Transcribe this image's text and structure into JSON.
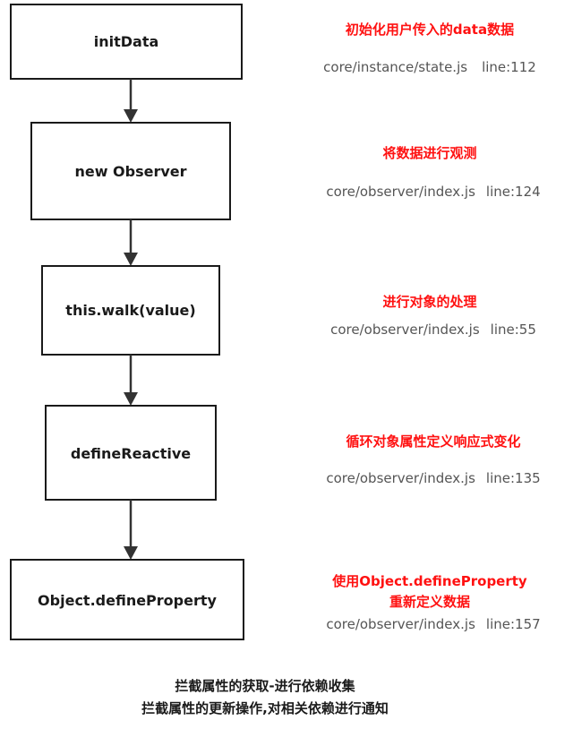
{
  "colors": {
    "accent_red": "#ff1111",
    "box_stroke": "#1a1a1a",
    "arrow": "#333333",
    "file_text": "#555555"
  },
  "steps": [
    {
      "label": "initData",
      "note_title": "初始化用户传入的data数据",
      "note_title_line2": "",
      "file": "core/instance/state.js",
      "line": "line:112"
    },
    {
      "label": "new Observer",
      "note_title": "将数据进行观测",
      "note_title_line2": "",
      "file": "core/observer/index.js",
      "line": "line:124"
    },
    {
      "label": "this.walk(value)",
      "note_title": "进行对象的处理",
      "note_title_line2": "",
      "file": "core/observer/index.js",
      "line": "line:55"
    },
    {
      "label": "defineReactive",
      "note_title": "循环对象属性定义响应式变化",
      "note_title_line2": "",
      "file": "core/observer/index.js",
      "line": "line:135"
    },
    {
      "label": "Object.defineProperty",
      "note_title": "使用Object.defineProperty",
      "note_title_line2": "重新定义数据",
      "file": "core/observer/index.js",
      "line": "line:157"
    }
  ],
  "footer": {
    "line1": "拦截属性的获取-进行依赖收集",
    "line2": "拦截属性的更新操作,对相关依赖进行通知"
  }
}
